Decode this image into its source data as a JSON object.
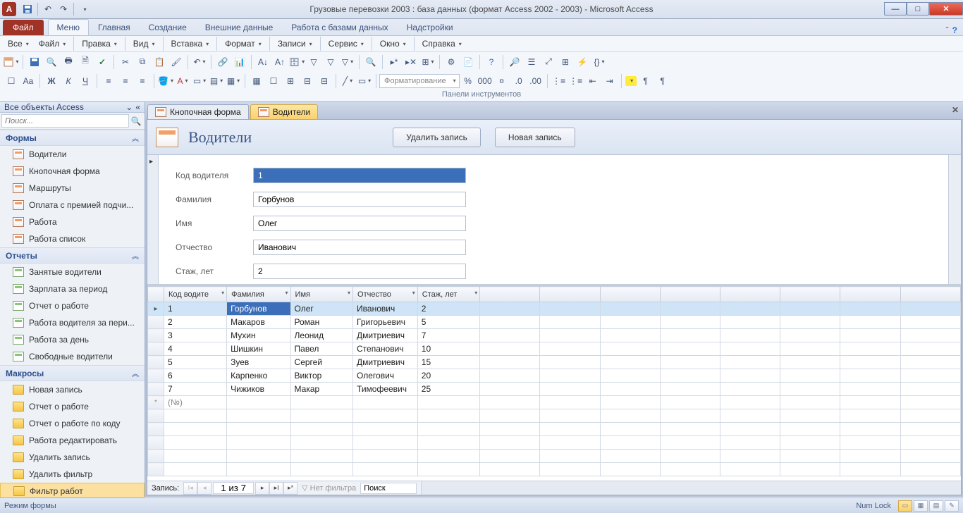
{
  "titlebar": {
    "app_letter": "A",
    "title": "Грузовые перевозки 2003 : база данных (формат Access 2002 - 2003)  -  Microsoft Access"
  },
  "ribbon": {
    "file": "Файл",
    "tabs": [
      "Меню",
      "Главная",
      "Создание",
      "Внешние данные",
      "Работа с базами данных",
      "Надстройки"
    ]
  },
  "menubar": [
    "Все",
    "Файл",
    "Правка",
    "Вид",
    "Вставка",
    "Формат",
    "Записи",
    "Сервис",
    "Окно",
    "Справка"
  ],
  "toolbar_caption": "Панели инструментов",
  "format_combo": "Форматирование",
  "nav": {
    "header": "Все объекты Access",
    "search_placeholder": "Поиск...",
    "groups": [
      {
        "title": "Формы",
        "items": [
          "Водители",
          "Кнопочная форма",
          "Маршруты",
          "Оплата с премией подчи...",
          "Работа",
          "Работа список"
        ],
        "icon": "form"
      },
      {
        "title": "Отчеты",
        "items": [
          "Занятые водители",
          "Зарплата за период",
          "Отчет о работе",
          "Работа водителя за пери...",
          "Работа за день",
          "Свободные водители"
        ],
        "icon": "report"
      },
      {
        "title": "Макросы",
        "items": [
          "Новая запись",
          "Отчет о работе",
          "Отчет о работе по коду",
          "Работа редактировать",
          "Удалить запись",
          "Удалить фильтр",
          "Фильтр работ"
        ],
        "icon": "macro"
      }
    ]
  },
  "doc": {
    "tabs": [
      {
        "label": "Кнопочная форма",
        "active": false
      },
      {
        "label": "Водители",
        "active": true
      }
    ],
    "form_title": "Водители",
    "btn_delete": "Удалить запись",
    "btn_new": "Новая запись",
    "fields": [
      {
        "label": "Код водителя",
        "value": "1",
        "selected": true
      },
      {
        "label": "Фамилия",
        "value": "Горбунов"
      },
      {
        "label": "Имя",
        "value": "Олег"
      },
      {
        "label": "Отчество",
        "value": "Иванович"
      },
      {
        "label": "Стаж, лет",
        "value": "2"
      }
    ],
    "columns": [
      "Код водите",
      "Фамилия",
      "Имя",
      "Отчество",
      "Стаж, лет"
    ],
    "rows": [
      [
        "1",
        "Горбунов",
        "Олег",
        "Иванович",
        "2"
      ],
      [
        "2",
        "Макаров",
        "Роман",
        "Григорьевич",
        "5"
      ],
      [
        "3",
        "Мухин",
        "Леонид",
        "Дмитриевич",
        "7"
      ],
      [
        "4",
        "Шишкин",
        "Павел",
        "Степанович",
        "10"
      ],
      [
        "5",
        "Зуев",
        "Сергей",
        "Дмитриевич",
        "15"
      ],
      [
        "6",
        "Карпенко",
        "Виктор",
        "Олегович",
        "20"
      ],
      [
        "7",
        "Чижиков",
        "Макар",
        "Тимофеевич",
        "25"
      ]
    ],
    "new_row": "(№)"
  },
  "recnav": {
    "label": "Запись:",
    "counter": "1 из 7",
    "filter": "Нет фильтра",
    "search": "Поиск"
  },
  "status": {
    "mode": "Режим формы",
    "numlock": "Num Lock"
  }
}
